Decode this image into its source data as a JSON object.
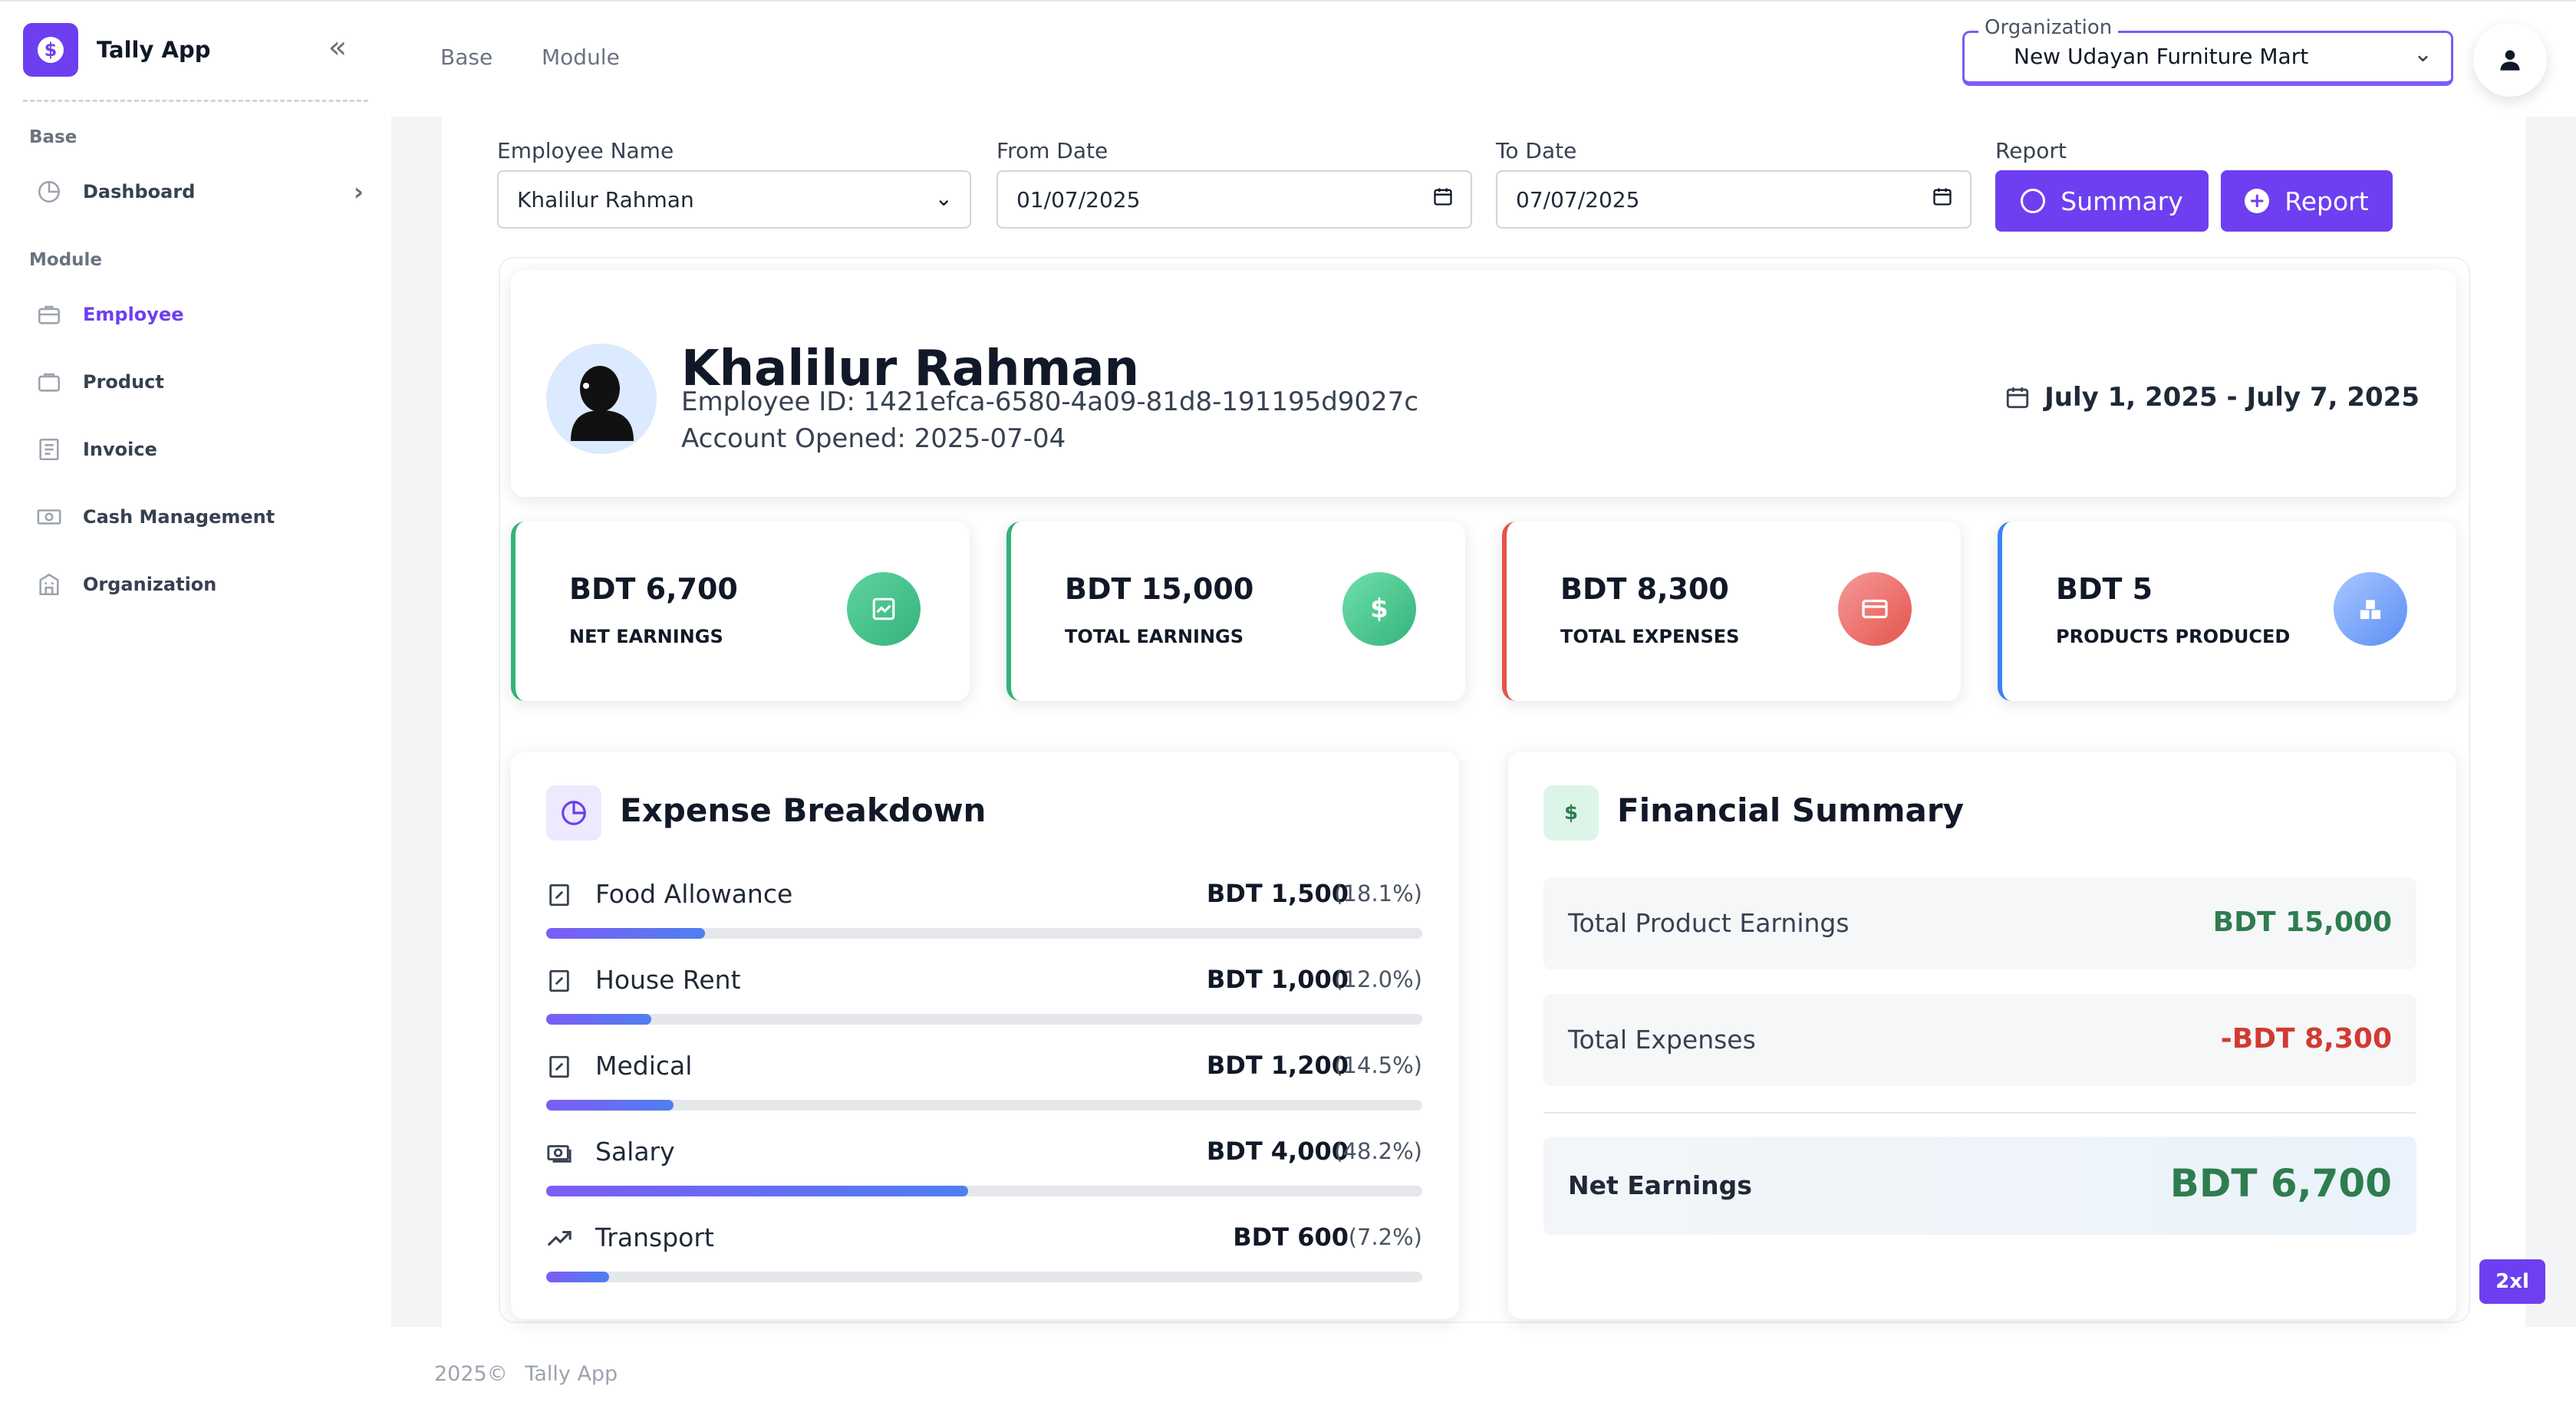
{
  "app": {
    "name": "Tally App"
  },
  "sidebar": {
    "sections": [
      "Base",
      "Module"
    ],
    "items": [
      {
        "label": "Dashboard",
        "icon": "pie-chart-icon"
      },
      {
        "label": "Employee",
        "icon": "briefcase-icon",
        "active": true
      },
      {
        "label": "Product",
        "icon": "box-icon"
      },
      {
        "label": "Invoice",
        "icon": "invoice-icon"
      },
      {
        "label": "Cash Management",
        "icon": "cash-icon"
      },
      {
        "label": "Organization",
        "icon": "building-icon"
      }
    ]
  },
  "topbar": {
    "breadcrumbs": [
      "Base",
      "Module"
    ],
    "org_label": "Organization",
    "org_value": "New Udayan Furniture Mart"
  },
  "filters": {
    "employee_label": "Employee Name",
    "employee_value": "Khalilur Rahman",
    "from_label": "From Date",
    "from_value": "01/07/2025",
    "to_label": "To Date",
    "to_value": "07/07/2025",
    "report_label": "Report",
    "summary_button": "Summary",
    "report_button": "Report"
  },
  "profile": {
    "name": "Khalilur Rahman",
    "employee_id": "Employee ID: 1421efca-6580-4a09-81d8-191195d9027c",
    "account_opened": "Account Opened: 2025-07-04",
    "date_range": "July 1, 2025 - July 7, 2025"
  },
  "stats": [
    {
      "amount": "BDT 6,700",
      "label": "NET EARNINGS",
      "color": "#34b37a",
      "icon": "chart-icon"
    },
    {
      "amount": "BDT 15,000",
      "label": "TOTAL EARNINGS",
      "color": "#34b37a",
      "icon": "dollar-icon"
    },
    {
      "amount": "BDT 8,300",
      "label": "TOTAL EXPENSES",
      "color": "#e5534b",
      "icon": "credit-card-icon"
    },
    {
      "amount": "BDT 5",
      "label": "PRODUCTS PRODUCED",
      "color": "#3b82f6",
      "icon": "boxes-icon"
    }
  ],
  "expense_breakdown": {
    "title": "Expense Breakdown",
    "items": [
      {
        "name": "Food Allowance",
        "amount": "BDT 1,500",
        "percent": "(18.1%)",
        "fraction": 0.181
      },
      {
        "name": "House Rent",
        "amount": "BDT 1,000",
        "percent": "(12.0%)",
        "fraction": 0.12
      },
      {
        "name": "Medical",
        "amount": "BDT 1,200",
        "percent": "(14.5%)",
        "fraction": 0.145
      },
      {
        "name": "Salary",
        "amount": "BDT 4,000",
        "percent": "(48.2%)",
        "fraction": 0.482
      },
      {
        "name": "Transport",
        "amount": "BDT 600",
        "percent": "(7.2%)",
        "fraction": 0.072
      }
    ]
  },
  "financial_summary": {
    "title": "Financial Summary",
    "icon_glyph": "$",
    "rows": [
      {
        "label": "Total Product Earnings",
        "value": "BDT 15,000",
        "color": "#2e7d4f"
      },
      {
        "label": "Total Expenses",
        "value": "-BDT 8,300",
        "color": "#d23a32"
      },
      {
        "label": "Net Earnings",
        "value": "BDT 6,700",
        "color": "#2e7d4f"
      }
    ]
  },
  "badge": "2xl",
  "footer": {
    "year": "2025©",
    "app": "Tally App"
  }
}
